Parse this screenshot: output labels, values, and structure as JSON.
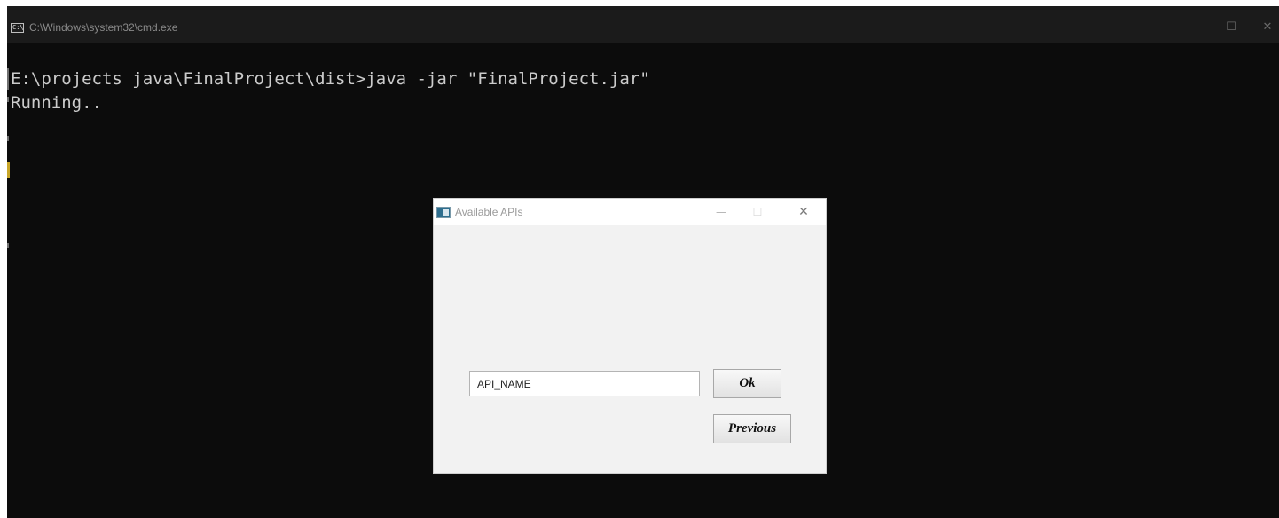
{
  "console_window": {
    "title": "C:\\Windows\\system32\\cmd.exe",
    "icon": "cmd-app-icon",
    "icon_text": "C:\\",
    "controls": {
      "minimize": "—",
      "maximize": "☐",
      "close": "✕"
    },
    "lines": [
      "E:\\projects java\\FinalProject\\dist>java -jar \"FinalProject.jar\"",
      "Running.."
    ]
  },
  "dialog": {
    "title": "Available APIs",
    "icon": "java-app-icon",
    "controls": {
      "minimize": "—",
      "maximize": "☐",
      "close": "✕"
    },
    "api_input": {
      "value": "API_NAME"
    },
    "ok_label": "Ok",
    "previous_label": "Previous"
  },
  "colors": {
    "console_background": "#0c0c0c",
    "console_text": "#cccccc",
    "dialog_background": "#f2f2f2"
  }
}
